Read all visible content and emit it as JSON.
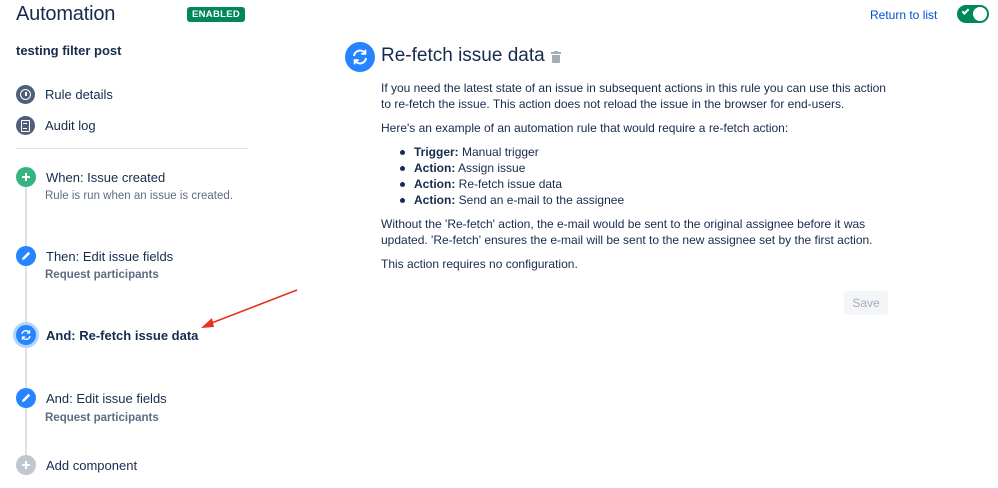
{
  "header": {
    "app_title": "Automation",
    "status_badge": "ENABLED",
    "return_link": "Return to list",
    "toggle_on": true
  },
  "sidebar": {
    "rule_name": "testing filter post",
    "links": [
      {
        "label": "Rule details",
        "icon": "info-icon"
      },
      {
        "label": "Audit log",
        "icon": "audit-log-icon"
      }
    ],
    "steps": [
      {
        "title": "When: Issue created",
        "subtitle": "Rule is run when an issue is created.",
        "icon": "plus-icon",
        "color": "#36b37e"
      },
      {
        "title": "Then: Edit issue fields",
        "subtitle": "Request participants",
        "icon": "pencil-icon",
        "color": "#2684ff"
      },
      {
        "title": "And: Re-fetch issue data",
        "subtitle": "",
        "icon": "refresh-icon",
        "color": "#2684ff",
        "selected": true
      },
      {
        "title": "And: Edit issue fields",
        "subtitle": "Request participants",
        "icon": "pencil-icon",
        "color": "#2684ff"
      },
      {
        "title": "Add component",
        "subtitle": "",
        "icon": "plus-icon",
        "color": "#c1c7d0"
      }
    ]
  },
  "main": {
    "title": "Re-fetch issue data",
    "para1": "If you need the latest state of an issue in subsequent actions in this rule you can use this action to re-fetch the issue. This action does not reload the issue in the browser for end-users.",
    "para2": "Here's an example of an automation rule that would require a re-fetch action:",
    "bullets": [
      {
        "label": "Trigger:",
        "text": "Manual trigger"
      },
      {
        "label": "Action:",
        "text": "Assign issue"
      },
      {
        "label": "Action:",
        "text": "Re-fetch issue data"
      },
      {
        "label": "Action:",
        "text": "Send an e-mail to the assignee"
      }
    ],
    "para3": "Without the 'Re-fetch' action, the e-mail would be sent to the original assignee before it was updated. 'Re-fetch' ensures the e-mail will be sent to the new assignee set by the first action.",
    "para4": "This action requires no configuration.",
    "save_label": "Save"
  },
  "colors": {
    "accent": "#2684ff",
    "success": "#00875a",
    "annotation_arrow": "#e5331f"
  }
}
